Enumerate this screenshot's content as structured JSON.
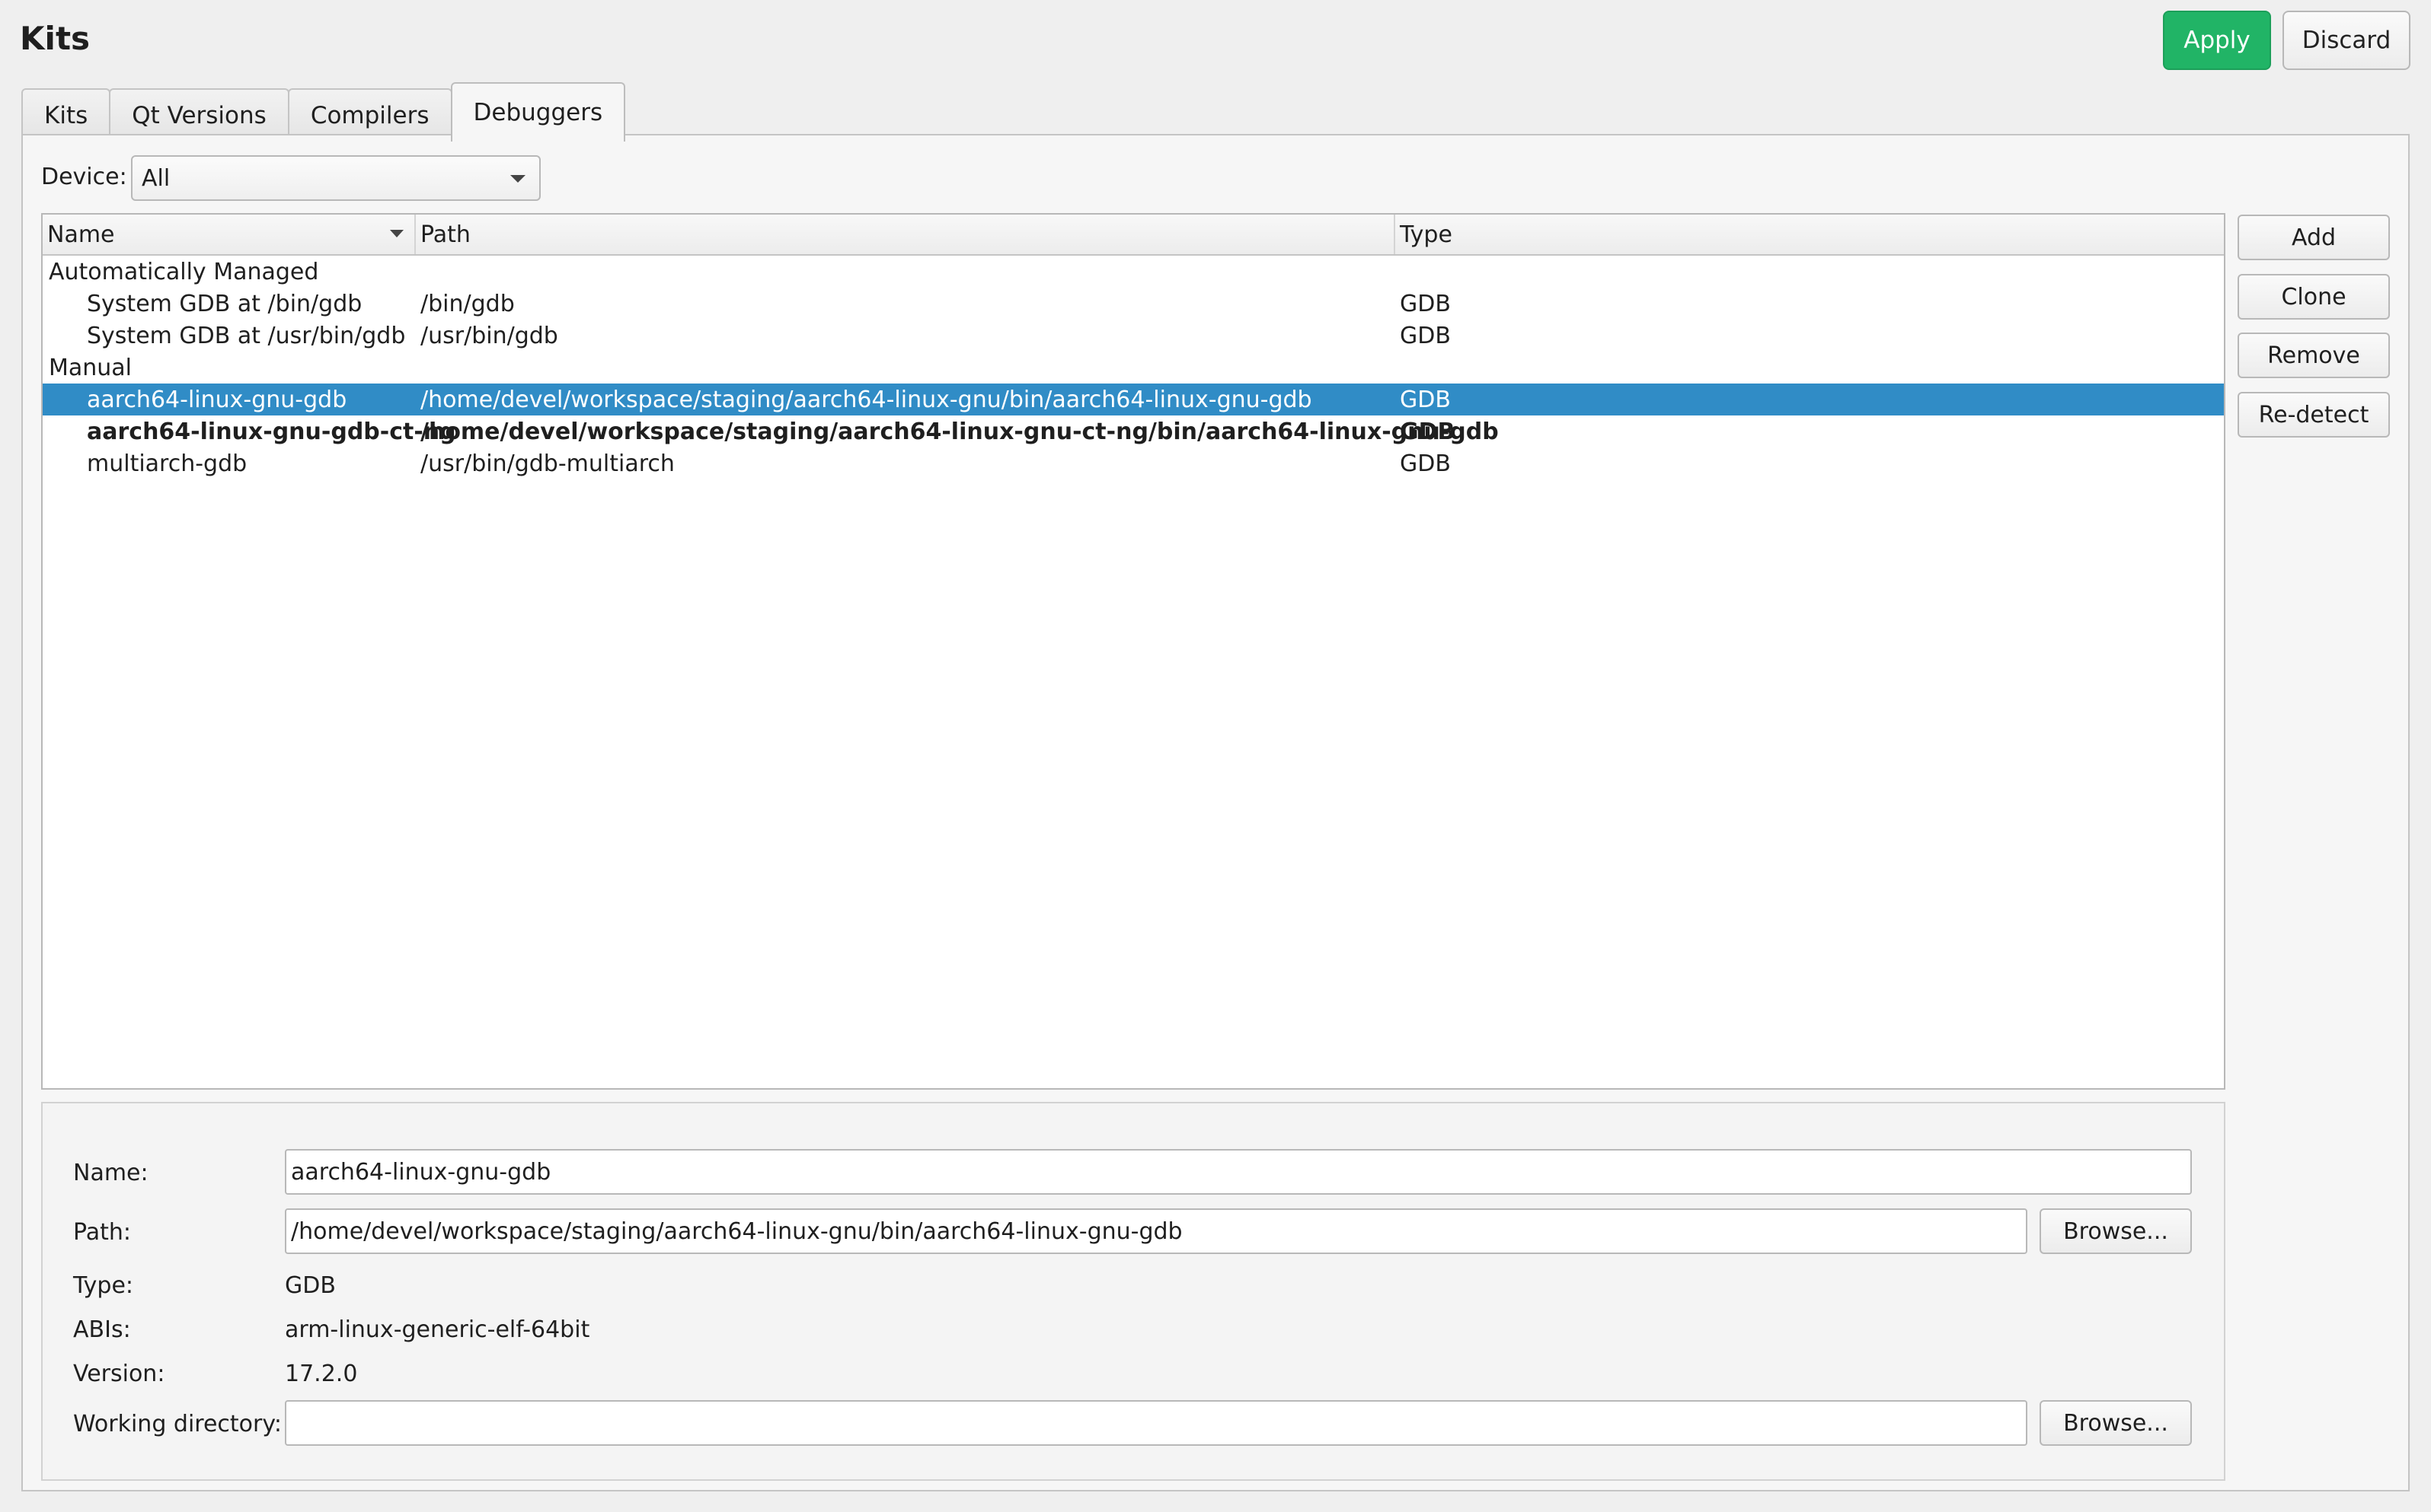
{
  "window": {
    "title": "Kits"
  },
  "actions": {
    "apply": "Apply",
    "discard": "Discard"
  },
  "tabs": [
    {
      "label": "Kits"
    },
    {
      "label": "Qt Versions"
    },
    {
      "label": "Compilers"
    },
    {
      "label": "Debuggers",
      "active": true
    }
  ],
  "device": {
    "label": "Device:",
    "value": "All"
  },
  "table": {
    "columns": [
      "Name",
      "Path",
      "Type"
    ],
    "groups": [
      {
        "label": "Automatically Managed",
        "rows": [
          {
            "name": "System GDB at /bin/gdb",
            "path": "/bin/gdb",
            "type": "GDB"
          },
          {
            "name": "System GDB at /usr/bin/gdb",
            "path": "/usr/bin/gdb",
            "type": "GDB"
          }
        ]
      },
      {
        "label": "Manual",
        "rows": [
          {
            "name": "aarch64-linux-gnu-gdb",
            "path": "/home/devel/workspace/staging/aarch64-linux-gnu/bin/aarch64-linux-gnu-gdb",
            "type": "GDB",
            "selected": true
          },
          {
            "name": "aarch64-linux-gnu-gdb-ct-ng",
            "path": "/home/devel/workspace/staging/aarch64-linux-gnu-ct-ng/bin/aarch64-linux-gnu-gdb",
            "type": "GDB",
            "bold": true
          },
          {
            "name": "multiarch-gdb",
            "path": "/usr/bin/gdb-multiarch",
            "type": "GDB"
          }
        ]
      }
    ]
  },
  "side_buttons": {
    "add": "Add",
    "clone": "Clone",
    "remove": "Remove",
    "redetect": "Re-detect"
  },
  "details": {
    "name_label": "Name:",
    "name_value": "aarch64-linux-gnu-gdb",
    "path_label": "Path:",
    "path_value": "/home/devel/workspace/staging/aarch64-linux-gnu/bin/aarch64-linux-gnu-gdb",
    "browse": "Browse...",
    "type_label": "Type:",
    "type_value": "GDB",
    "abis_label": "ABIs:",
    "abis_value": "arm-linux-generic-elf-64bit",
    "version_label": "Version:",
    "version_value": "17.2.0",
    "workdir_label": "Working directory:",
    "workdir_value": ""
  }
}
